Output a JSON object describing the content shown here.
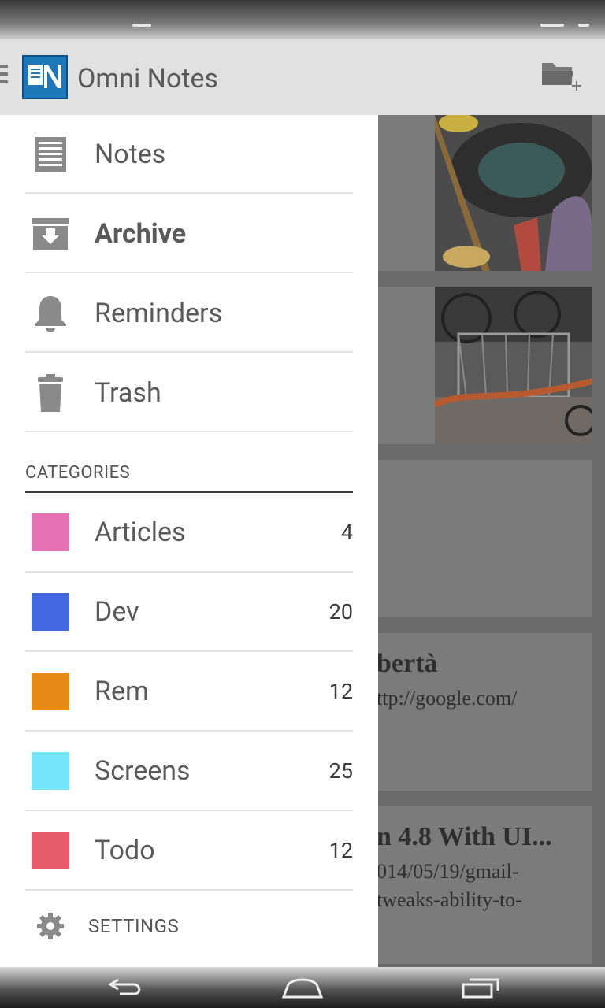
{
  "app": {
    "title": "Omni Notes"
  },
  "nav": [
    {
      "label": "Notes",
      "icon": "notes-icon",
      "bold": false
    },
    {
      "label": "Archive",
      "icon": "archive-icon",
      "bold": true
    },
    {
      "label": "Reminders",
      "icon": "bell-icon",
      "bold": false
    },
    {
      "label": "Trash",
      "icon": "trash-icon",
      "bold": false
    }
  ],
  "categories_header": "CATEGORIES",
  "categories": [
    {
      "label": "Articles",
      "count": "4",
      "color": "#e472b4"
    },
    {
      "label": "Dev",
      "count": "20",
      "color": "#4468e0"
    },
    {
      "label": "Rem",
      "count": "12",
      "color": "#e88a17"
    },
    {
      "label": "Screens",
      "count": "25",
      "color": "#75e5fc"
    },
    {
      "label": "Todo",
      "count": "12",
      "color": "#e85b6a"
    }
  ],
  "settings_label": "SETTINGS",
  "background_cards": {
    "card4": {
      "title": "bertà",
      "line1": "ttp://google.com/"
    },
    "card5": {
      "title": "n 4.8 With UI...",
      "line1": "014/05/19/gmail-",
      "line2": "tweaks-ability-to-"
    }
  }
}
